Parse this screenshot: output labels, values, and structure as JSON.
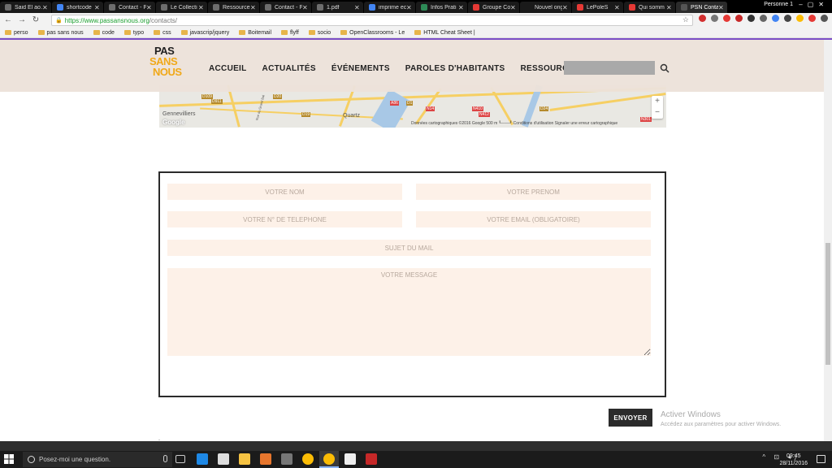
{
  "browser": {
    "tabs": [
      {
        "label": "Said El ao…",
        "color": "#6d6d6d"
      },
      {
        "label": "shortcode",
        "color": "#4285f4"
      },
      {
        "label": "Contact - P",
        "color": "#6d6d6d"
      },
      {
        "label": "Le Collecti",
        "color": "#6d6d6d"
      },
      {
        "label": "Ressources",
        "color": "#6d6d6d"
      },
      {
        "label": "Contact - P",
        "color": "#6d6d6d"
      },
      {
        "label": "1.pdf",
        "color": "#6d6d6d"
      },
      {
        "label": "imprime ec",
        "color": "#4285f4"
      },
      {
        "label": "Infos Prati",
        "color": "#2e8b57"
      },
      {
        "label": "Groupe Co",
        "color": "#e53935"
      },
      {
        "label": "Nouvel onglet",
        "color": ""
      },
      {
        "label": "LePoleS",
        "color": "#e53935"
      },
      {
        "label": "Qui somm",
        "color": "#e53935"
      },
      {
        "label": "PSN Conta",
        "color": "#555555"
      }
    ],
    "profile": "Personne 1",
    "url_host": "https://www.passansnous.org",
    "url_path": "/contacts/",
    "bookmarks": [
      "perso",
      "pas sans nous",
      "code",
      "typo",
      "css",
      "javascrip/jquery",
      "Boitemail",
      "flyff",
      "socio",
      "OpenClassrooms - Le",
      "HTML Cheat Sheet |"
    ]
  },
  "header": {
    "logo": {
      "line1": "PAS",
      "line2": "SANS",
      "line3": "NOUS",
      "color_dark": "#1f1f1f",
      "color_accent": "#f0a818"
    },
    "nav": [
      "ACCUEIL",
      "ACTUALITÉS",
      "ÉVÉNEMENTS",
      "PAROLES D'HABITANTS",
      "RESSOURCES"
    ]
  },
  "map": {
    "labels": {
      "gennevilliers": "Gennevilliers",
      "quartz": "Quartz",
      "road_d911": "D911",
      "road_d109": "D109",
      "road_d19": "D19",
      "road_a86": "A86",
      "road_d1": "D1",
      "road_n14": "N14",
      "road_n410": "N410",
      "road_n412": "N412",
      "road_d24": "D24",
      "road_n301": "N301",
      "road_d20": "D20",
      "street": "Rue du Grand Bal"
    },
    "footer": "Données cartographiques ©2016 Google   500 m ┖───┚   Conditions d'utilisation   Signaler une erreur cartographique",
    "google": "Google",
    "zoom_in": "+",
    "zoom_out": "−"
  },
  "form": {
    "nom": "VOTRE NOM",
    "prenom": "VOTRE PRENOM",
    "telephone": "VOTRE N° DE TELEPHONE",
    "email": "VOTRE EMAIL (OBLIGATOIRE)",
    "sujet": "SUJET DU MAIL",
    "message": "VOTRE MESSAGE",
    "send": "ENVOYER"
  },
  "watermark": {
    "title": "Activer Windows",
    "subtitle": "Accédez aux paramètres pour activer Windows."
  },
  "page_marker": "˯",
  "taskbar": {
    "search_placeholder": "Posez-moi une question.",
    "time": "09:45",
    "date": "28/11/2016",
    "tray": "^ ⊡ ◂)"
  }
}
